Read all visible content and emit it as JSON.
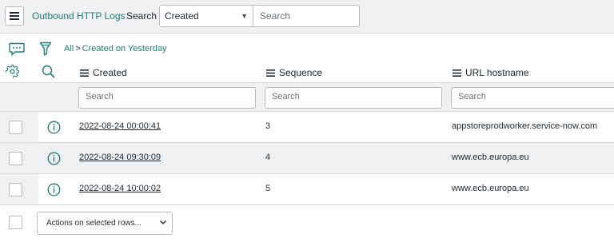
{
  "header": {
    "title": "Outbound HTTP Logs",
    "search_label": "Search",
    "field_select_value": "Created",
    "search_placeholder": "Search"
  },
  "breadcrumb": {
    "root": "All",
    "separator": ">",
    "filter": "Created on Yesterday"
  },
  "columns": [
    {
      "label": "Created",
      "search_placeholder": "Search"
    },
    {
      "label": "Sequence",
      "search_placeholder": "Search"
    },
    {
      "label": "URL hostname",
      "search_placeholder": "Search"
    }
  ],
  "rows": [
    {
      "created": "2022-08-24 00:00:41",
      "sequence": "3",
      "url_hostname": "appstoreprodworker.service-now.com"
    },
    {
      "created": "2022-08-24 09:30:09",
      "sequence": "4",
      "url_hostname": "www.ecb.europa.eu"
    },
    {
      "created": "2022-08-24 10:00:02",
      "sequence": "5",
      "url_hostname": "www.ecb.europa.eu"
    }
  ],
  "footer": {
    "actions_label": "Actions on selected rows..."
  },
  "colors": {
    "accent": "#1d7e74",
    "band": "#eef0f2",
    "border": "#b7bcc1"
  },
  "icons": [
    "hamburger-icon",
    "caret-down-icon",
    "comment-icon",
    "filter-icon",
    "gear-icon",
    "magnifier-icon",
    "column-menu-icon",
    "info-icon",
    "chevron-down-icon"
  ]
}
